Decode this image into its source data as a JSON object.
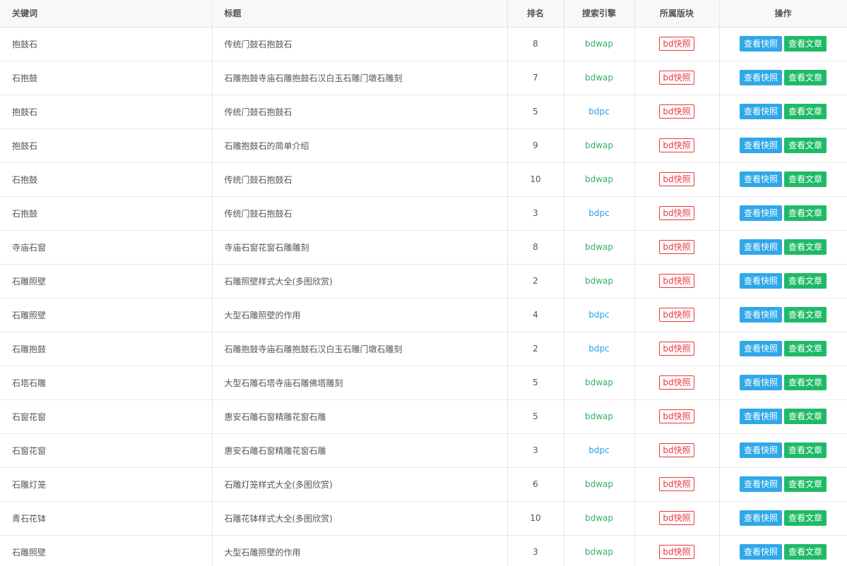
{
  "headers": {
    "keyword": "关键词",
    "title": "标题",
    "rank": "排名",
    "engine": "搜索引擎",
    "section": "所属版块",
    "actions": "操作"
  },
  "labels": {
    "snapshot_button": "查看快照",
    "article_button": "查看文章"
  },
  "colors": {
    "bdwap": "#2fb360",
    "bdpc": "#2aa1e6",
    "section_tag": "#e8383d",
    "snapshot_button": "#2fa8e8",
    "article_button": "#1fba66"
  },
  "rows": [
    {
      "keyword": "抱鼓石",
      "title": "传统门鼓石抱鼓石",
      "rank": "8",
      "engine": "bdwap",
      "section": "bd快照"
    },
    {
      "keyword": "石抱鼓",
      "title": "石雕抱鼓寺庙石雕抱鼓石汉白玉石雕门墩石雕刻",
      "rank": "7",
      "engine": "bdwap",
      "section": "bd快照"
    },
    {
      "keyword": "抱鼓石",
      "title": "传统门鼓石抱鼓石",
      "rank": "5",
      "engine": "bdpc",
      "section": "bd快照"
    },
    {
      "keyword": "抱鼓石",
      "title": "石雕抱鼓石的简单介绍",
      "rank": "9",
      "engine": "bdwap",
      "section": "bd快照"
    },
    {
      "keyword": "石抱鼓",
      "title": "传统门鼓石抱鼓石",
      "rank": "10",
      "engine": "bdwap",
      "section": "bd快照"
    },
    {
      "keyword": "石抱鼓",
      "title": "传统门鼓石抱鼓石",
      "rank": "3",
      "engine": "bdpc",
      "section": "bd快照"
    },
    {
      "keyword": "寺庙石窗",
      "title": "寺庙石窗花窗石雕雕刻",
      "rank": "8",
      "engine": "bdwap",
      "section": "bd快照"
    },
    {
      "keyword": "石雕照壁",
      "title": "石雕照壁样式大全(多图欣赏)",
      "rank": "2",
      "engine": "bdwap",
      "section": "bd快照"
    },
    {
      "keyword": "石雕照壁",
      "title": "大型石雕照壁的作用",
      "rank": "4",
      "engine": "bdpc",
      "section": "bd快照"
    },
    {
      "keyword": "石雕抱鼓",
      "title": "石雕抱鼓寺庙石雕抱鼓石汉白玉石雕门墩石雕刻",
      "rank": "2",
      "engine": "bdpc",
      "section": "bd快照"
    },
    {
      "keyword": "石塔石雕",
      "title": "大型石雕石塔寺庙石雕佛塔雕刻",
      "rank": "5",
      "engine": "bdwap",
      "section": "bd快照"
    },
    {
      "keyword": "石窗花窗",
      "title": "惠安石雕石窗精雕花窗石雕",
      "rank": "5",
      "engine": "bdwap",
      "section": "bd快照"
    },
    {
      "keyword": "石窗花窗",
      "title": "惠安石雕石窗精雕花窗石雕",
      "rank": "3",
      "engine": "bdpc",
      "section": "bd快照"
    },
    {
      "keyword": "石雕灯笼",
      "title": "石雕灯笼样式大全(多图欣赏)",
      "rank": "6",
      "engine": "bdwap",
      "section": "bd快照"
    },
    {
      "keyword": "青石花钵",
      "title": "石雕花钵样式大全(多图欣赏)",
      "rank": "10",
      "engine": "bdwap",
      "section": "bd快照"
    },
    {
      "keyword": "石雕照壁",
      "title": "大型石雕照壁的作用",
      "rank": "3",
      "engine": "bdwap",
      "section": "bd快照"
    }
  ]
}
